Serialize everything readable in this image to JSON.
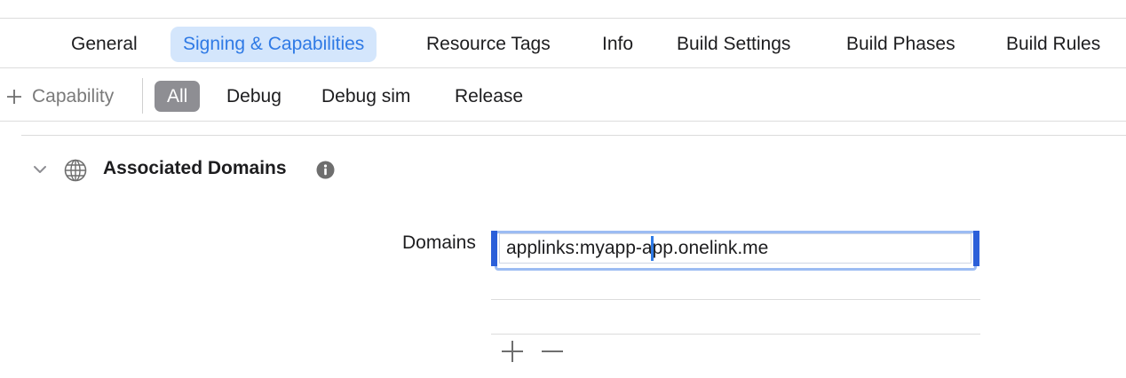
{
  "tabs": [
    {
      "label": "General",
      "selected": false
    },
    {
      "label": "Signing & Capabilities",
      "selected": true
    },
    {
      "label": "Resource Tags",
      "selected": false
    },
    {
      "label": "Info",
      "selected": false
    },
    {
      "label": "Build Settings",
      "selected": false
    },
    {
      "label": "Build Phases",
      "selected": false
    },
    {
      "label": "Build Rules",
      "selected": false
    }
  ],
  "filter_bar": {
    "add_capability": {
      "icon": "plus-icon",
      "label": "Capability"
    },
    "configs": [
      {
        "label": "All",
        "selected": true
      },
      {
        "label": "Debug",
        "selected": false
      },
      {
        "label": "Debug sim",
        "selected": false
      },
      {
        "label": "Release",
        "selected": false
      }
    ]
  },
  "section": {
    "title": "Associated Domains",
    "icons": {
      "disclosure": "chevron-down-icon",
      "capability": "globe-icon",
      "info": "info-icon"
    },
    "domains": {
      "label": "Domains",
      "entries": [
        "applinks:myapp-app.onelink.me"
      ],
      "add_icon": "plus-icon",
      "remove_icon": "minus-icon"
    }
  },
  "colors": {
    "accent": "#2f7ae5",
    "selected_tab_bg": "#d4e6fc",
    "selected_filter_bg": "#8e8e93",
    "focus_edge": "#2b5fd9"
  }
}
